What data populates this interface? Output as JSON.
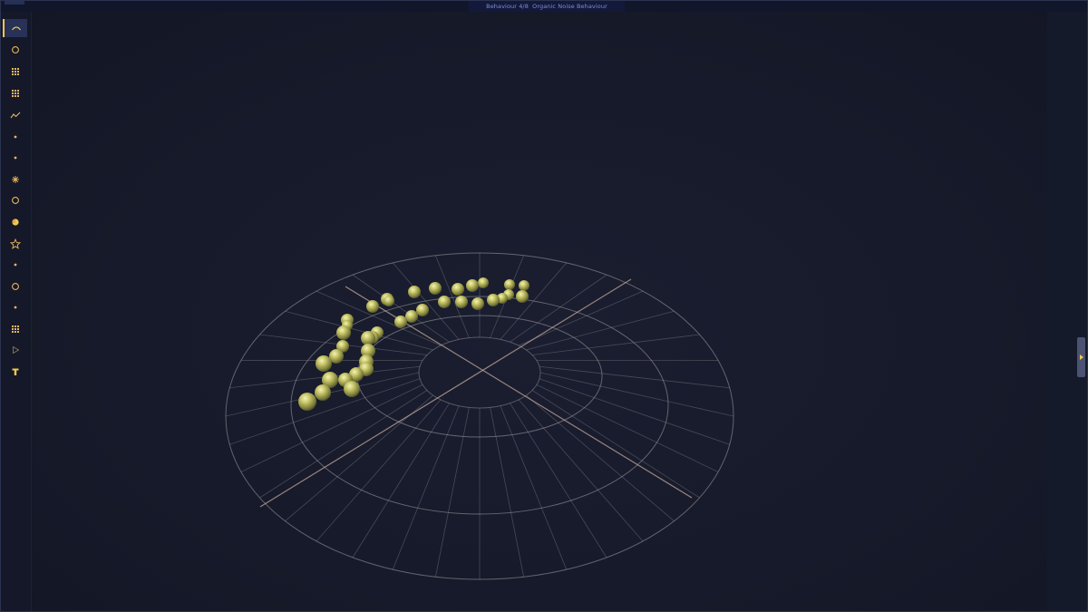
{
  "header": {
    "behaviour_counter": "Behaviour 4/8",
    "behaviour_name": "Organic Noise Behaviour"
  },
  "sidebar": {
    "items": [
      {
        "name": "arc",
        "icon": "arc-icon",
        "active": true
      },
      {
        "name": "circle",
        "icon": "circle-icon"
      },
      {
        "name": "grid",
        "icon": "grid-icon"
      },
      {
        "name": "grid-2",
        "icon": "grid-icon"
      },
      {
        "name": "wave",
        "icon": "wave-icon"
      },
      {
        "name": "point",
        "icon": "dot-icon"
      },
      {
        "name": "point-2",
        "icon": "dot-icon"
      },
      {
        "name": "burst",
        "icon": "burst-icon"
      },
      {
        "name": "ring",
        "icon": "circle-icon"
      },
      {
        "name": "pie",
        "icon": "pie-icon"
      },
      {
        "name": "star",
        "icon": "star-icon"
      },
      {
        "name": "point-3",
        "icon": "dot-icon"
      },
      {
        "name": "ring-2",
        "icon": "circle-icon"
      },
      {
        "name": "point-4",
        "icon": "dot-icon"
      },
      {
        "name": "grid-3",
        "icon": "grid-icon"
      },
      {
        "name": "play",
        "icon": "play-icon"
      },
      {
        "name": "text",
        "icon": "text-icon"
      }
    ]
  },
  "right_panel": {
    "toggle_icon": "chevron-right-icon"
  },
  "colors": {
    "background": "#161a2a",
    "accent": "#f2c94c",
    "title_text": "#7f8fd8",
    "sphere": "#c9c76a",
    "grid_lines": "#a3a0a4",
    "axis_lines": "#c6a89a"
  }
}
